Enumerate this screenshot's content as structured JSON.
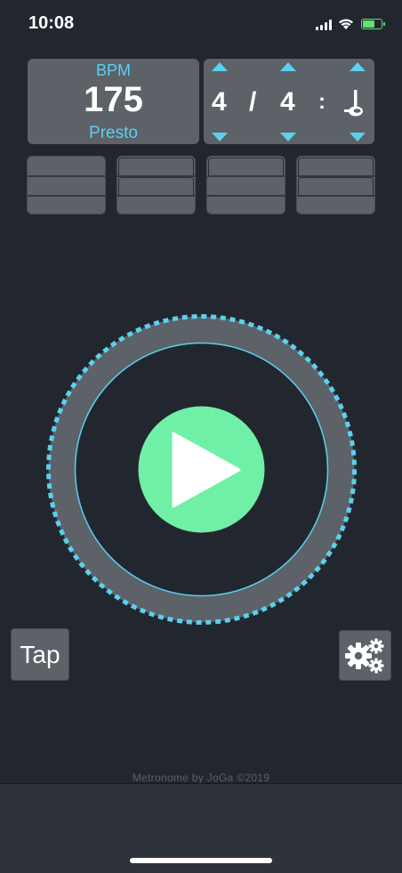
{
  "status": {
    "time": "10:08",
    "battery_level": 0.7,
    "battery_color": "#64e06c"
  },
  "bpm": {
    "label": "BPM",
    "value": "175",
    "tempo_name": "Presto"
  },
  "time_signature": {
    "beats": "4",
    "slash": "/",
    "note_value": "4",
    "colon": ":",
    "subdivision_icon": "quarter-note-icon"
  },
  "sound_buttons": [
    {
      "name": "sound-option-1"
    },
    {
      "name": "sound-option-2"
    },
    {
      "name": "sound-option-3"
    },
    {
      "name": "sound-option-4"
    }
  ],
  "controls": {
    "play_icon": "play-icon",
    "tap_label": "Tap",
    "settings_icon": "gears-icon"
  },
  "footer": {
    "credit": "Metronome by JoGa ©2019"
  },
  "colors": {
    "accent_cyan": "#5ad1f0",
    "play_green": "#6ff0a6",
    "panel_gray": "#5c6268",
    "background": "#22272f"
  }
}
